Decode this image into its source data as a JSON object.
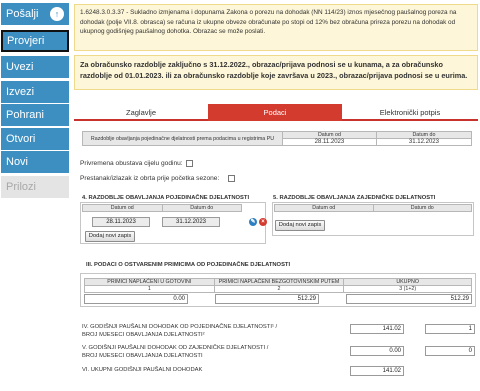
{
  "sidebar": {
    "items": [
      {
        "label": "Pošalji"
      },
      {
        "label": "Provjeri"
      },
      {
        "label": "Uvezi"
      },
      {
        "label": "Izvezi"
      },
      {
        "label": "Pohrani"
      },
      {
        "label": "Otvori"
      },
      {
        "label": "Novi"
      },
      {
        "label": "Prilozi"
      }
    ],
    "send_icon": "cloud-upload-icon"
  },
  "notice1": "1.6248.3.0.3.37 - Sukladno izmjenama i dopunama Zakona o porezu na dohodak (NN 114/23) iznos mjesečnog paušalnog poreza na dohodak (polje VII.8. obrasca) se računa iz ukupne obveze obračunate po stopi od 12% bez obračuna prireza porezu na dohodak od ukupnog godišnjeg paušalnog dohotka. Obrazac se može poslati.",
  "notice2": "Za obračunsko razdoblje zaključno s 31.12.2022., obrazac/prijava podnosi se u kunama, a za obračunsko razdoblje od 01.01.2023. ili za obračunsko razdoblje koje završava u 2023., obrazac/prijava podnosi se u eurima.",
  "tabs": [
    {
      "label": "Zaglavlje"
    },
    {
      "label": "Podaci"
    },
    {
      "label": "Elektronički potpis"
    }
  ],
  "period_table": {
    "header_desc": "Razdoblje obavljanja pojedinačne djelatnosti prema podacima u registrima PU",
    "header_from": "Datum od",
    "header_to": "Datum do",
    "from": "28.11.2023",
    "to": "31.12.2023"
  },
  "checks": {
    "temporary_label": "Privremena obustava cijelu godinu:",
    "cessation_label": "Prestanak/izlazak iz obrta prije početka sezone:"
  },
  "section4": {
    "title": "4. RAZDOBLJE OBAVLJANJA POJEDINAČNE DJELATNOSTI",
    "col_from": "Datum od",
    "col_to": "Datum do",
    "from": "28.11.2023",
    "to": "31.12.2023",
    "add_label": "Dodaj novi zapis"
  },
  "section5": {
    "title": "5. RAZDOBLJE OBAVLJANJA ZAJEDNIČKE DJELATNOSTI",
    "col_from": "Datum od",
    "col_to": "Datum do",
    "add_label": "Dodaj novi zapis"
  },
  "section_income": {
    "title": "III. PODACI O OSTVARENIM PRIMICIMA OD POJEDINAČNE DJELATNOSTI",
    "col1": "PRIMICI NAPLAĆENI U GOTOVINI",
    "col2": "PRIMICI NAPLAĆENI BEZGOTOVINSKIM PUTEM",
    "col3": "UKUPNO",
    "num1": "1",
    "num2": "2",
    "num3": "3 (1+2)",
    "cash": "0.00",
    "noncash": "512.29",
    "total": "512.29"
  },
  "summary": {
    "iv_label_1": "IV. GODIŠNJI PAUŠALNI DOHODAK OD POJEDINAČNE DJELATNOSTI¹ /",
    "iv_label_2": "BROJ MJESECI OBAVLJANJA DJELATNOSTI²",
    "iv_amount": "141.02",
    "iv_months": "1",
    "v_label_1": "V. GODIŠNJI PAUŠALNI DOHODAK OD ZAJEDNIČKE DJELATNOSTI /",
    "v_label_2": "BROJ MJESECI OBAVLJANJA DJELATNOSTI",
    "v_amount": "0.00",
    "v_months": "0",
    "vi_label": "VI. UKUPNI GODIŠNJI PAUŠALNI DOHODAK",
    "vi_amount": "141.02"
  },
  "colors": {
    "sidebar_blue": "#3d8fc1",
    "tab_red": "#d33b2f",
    "notice_bg": "#fdf6d8"
  }
}
